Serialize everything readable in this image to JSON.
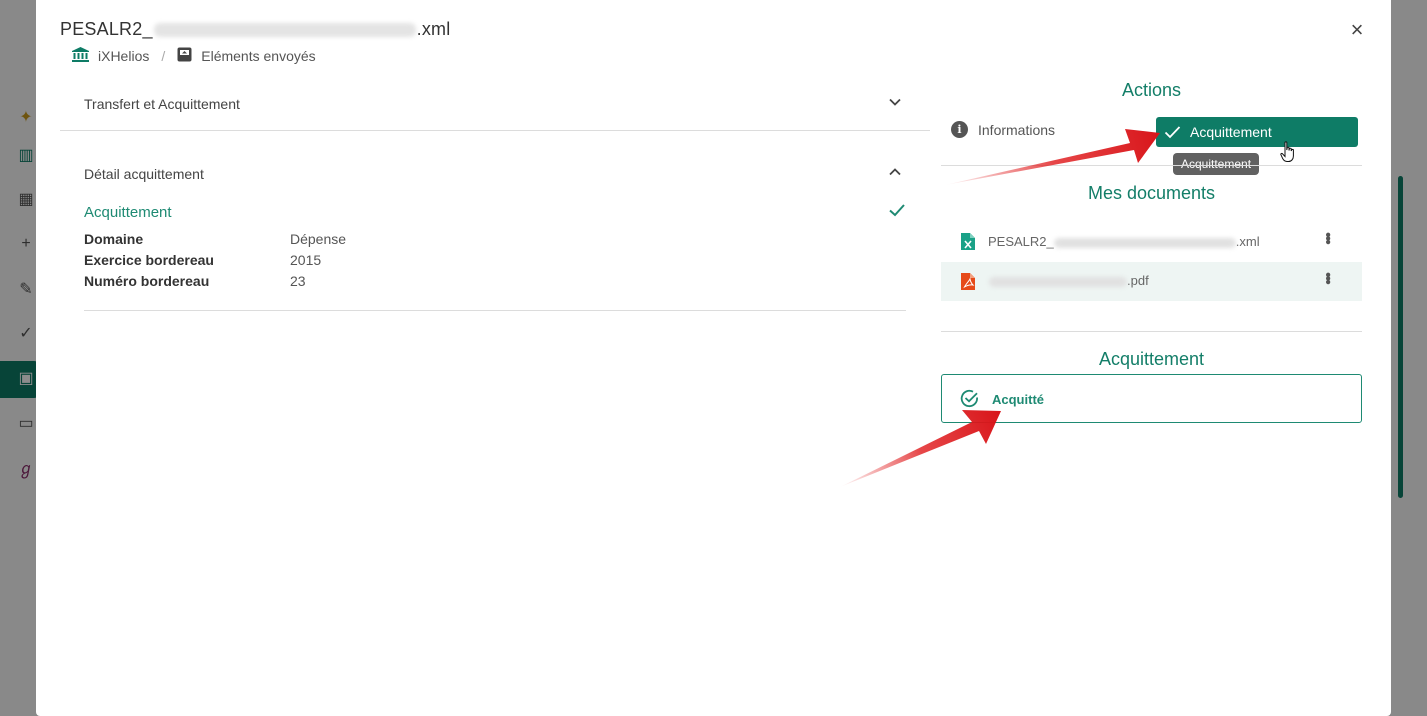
{
  "modal": {
    "title_prefix": "PESALR2_",
    "title_suffix": ".xml",
    "close_symbol": "×"
  },
  "breadcrumb": {
    "items": [
      {
        "label": "iXHelios",
        "icon": "bank-icon"
      },
      {
        "label": "Eléments envoyés",
        "icon": "sent-box-icon"
      }
    ],
    "separator": "/"
  },
  "left_panel": {
    "section_transfer": "Transfert et Acquittement",
    "section_detail": "Détail acquittement",
    "acq_title": "Acquittement",
    "fields": [
      {
        "key": "Domaine",
        "value": "Dépense"
      },
      {
        "key": "Exercice bordereau",
        "value": "2015"
      },
      {
        "key": "Numéro bordereau",
        "value": "23"
      }
    ]
  },
  "right_panel": {
    "actions_title": "Actions",
    "tab_info_label": "Informations",
    "tab_acq_label": "Acquittement",
    "tooltip": "Acquittement",
    "documents_title": "Mes documents",
    "documents": [
      {
        "prefix": "PESALR2_",
        "suffix": ".xml",
        "type": "xml"
      },
      {
        "prefix": "",
        "suffix": ".pdf",
        "type": "pdf"
      }
    ],
    "status_title": "Acquittement",
    "status_label": "Acquitté"
  },
  "colors": {
    "accent": "#0e7c66",
    "accent_text": "#1e8a73",
    "pdf": "#e64a19",
    "annotation": "#e0191b"
  }
}
